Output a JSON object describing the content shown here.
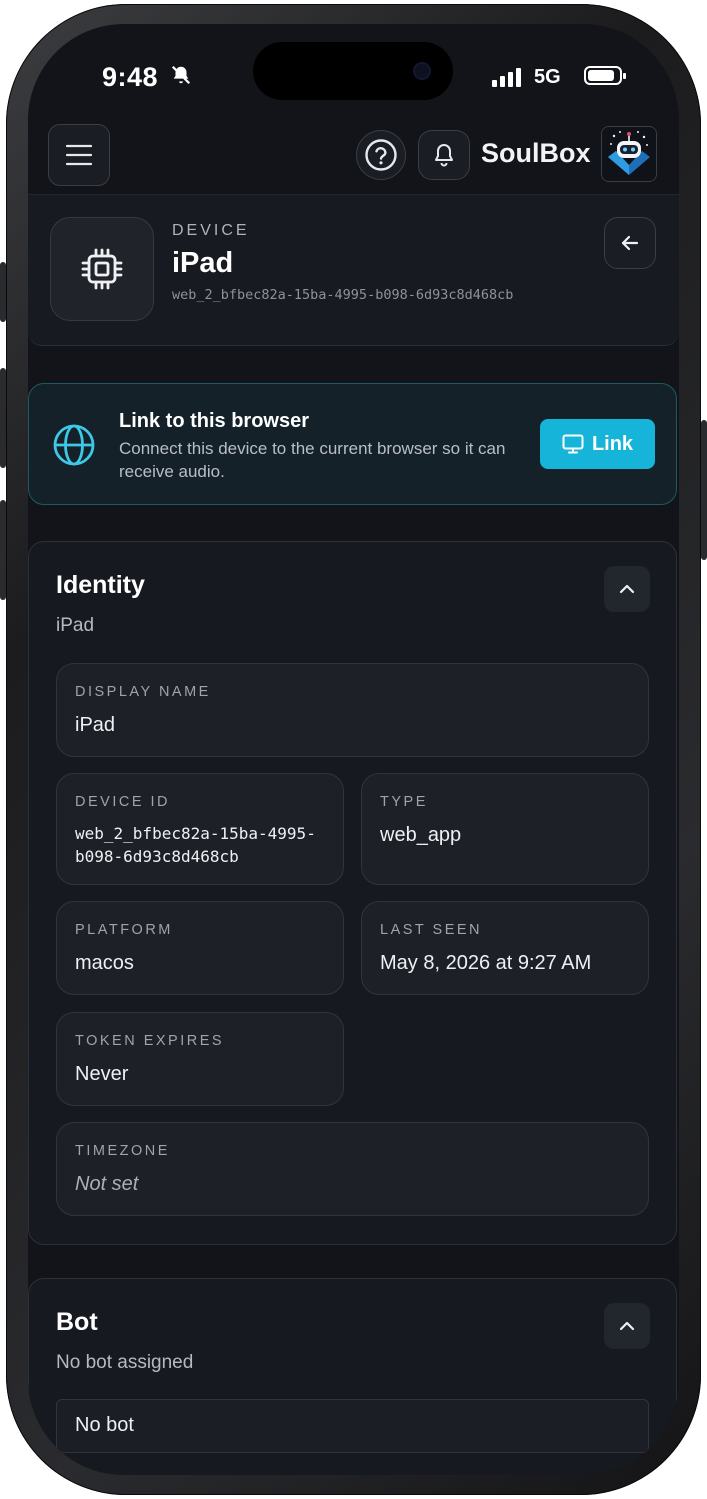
{
  "status_bar": {
    "time": "9:48",
    "network": "5G"
  },
  "header": {
    "brand": "SoulBox"
  },
  "device": {
    "kicker": "DEVICE",
    "name": "iPad",
    "id": "web_2_bfbec82a-15ba-4995-b098-6d93c8d468cb"
  },
  "link_card": {
    "title": "Link to this browser",
    "description": "Connect this device to the current browser so it can receive audio.",
    "button_label": "Link"
  },
  "identity": {
    "title": "Identity",
    "subtitle": "iPad",
    "fields": {
      "display_name": {
        "label": "DISPLAY NAME",
        "value": "iPad"
      },
      "device_id": {
        "label": "DEVICE ID",
        "value": "web_2_bfbec82a-15ba-4995-b098-6d93c8d468cb"
      },
      "type": {
        "label": "TYPE",
        "value": "web_app"
      },
      "platform": {
        "label": "PLATFORM",
        "value": "macos"
      },
      "last_seen": {
        "label": "LAST SEEN",
        "value": "May 8, 2026 at 9:27 AM"
      },
      "token_expires": {
        "label": "TOKEN EXPIRES",
        "value": "Never"
      },
      "timezone": {
        "label": "TIMEZONE",
        "value": "Not set"
      }
    }
  },
  "bot": {
    "title": "Bot",
    "subtitle": "No bot assigned",
    "select_value": "No bot"
  },
  "colors": {
    "accent": "#16b4d8",
    "background": "#121419"
  }
}
